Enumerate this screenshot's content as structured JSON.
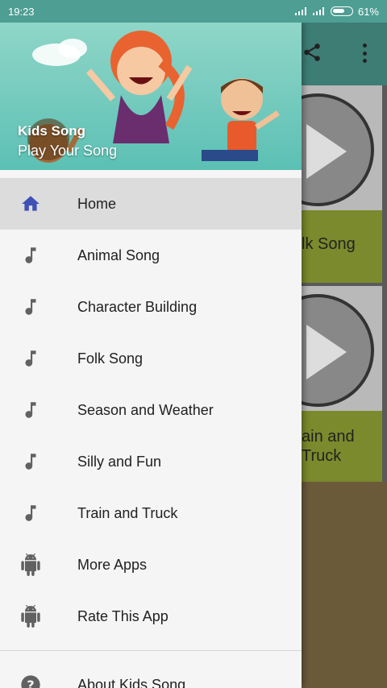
{
  "status_bar": {
    "time": "19:23",
    "battery": "61%"
  },
  "background_app": {
    "cards": [
      {
        "title": "lk Song"
      },
      {
        "title": "ain and\nTruck"
      }
    ]
  },
  "drawer": {
    "header": {
      "title": "Kids Song",
      "subtitle": "Play Your Song"
    },
    "items": [
      {
        "label": "Home",
        "icon": "home-icon",
        "active": true
      },
      {
        "label": "Animal Song",
        "icon": "music-note-icon"
      },
      {
        "label": "Character Building",
        "icon": "music-note-icon"
      },
      {
        "label": "Folk Song",
        "icon": "music-note-icon"
      },
      {
        "label": "Season and Weather",
        "icon": "music-note-icon"
      },
      {
        "label": "Silly and Fun",
        "icon": "music-note-icon"
      },
      {
        "label": "Train and Truck",
        "icon": "music-note-icon"
      },
      {
        "label": "More Apps",
        "icon": "android-icon"
      },
      {
        "label": "Rate This App",
        "icon": "android-icon"
      }
    ],
    "footer_items": [
      {
        "label": "About Kids Song",
        "icon": "help-icon"
      }
    ]
  },
  "colors": {
    "accent": "#3f51b5",
    "header_bg": "#5cc0b4",
    "status_bar": "#4e9e94"
  }
}
